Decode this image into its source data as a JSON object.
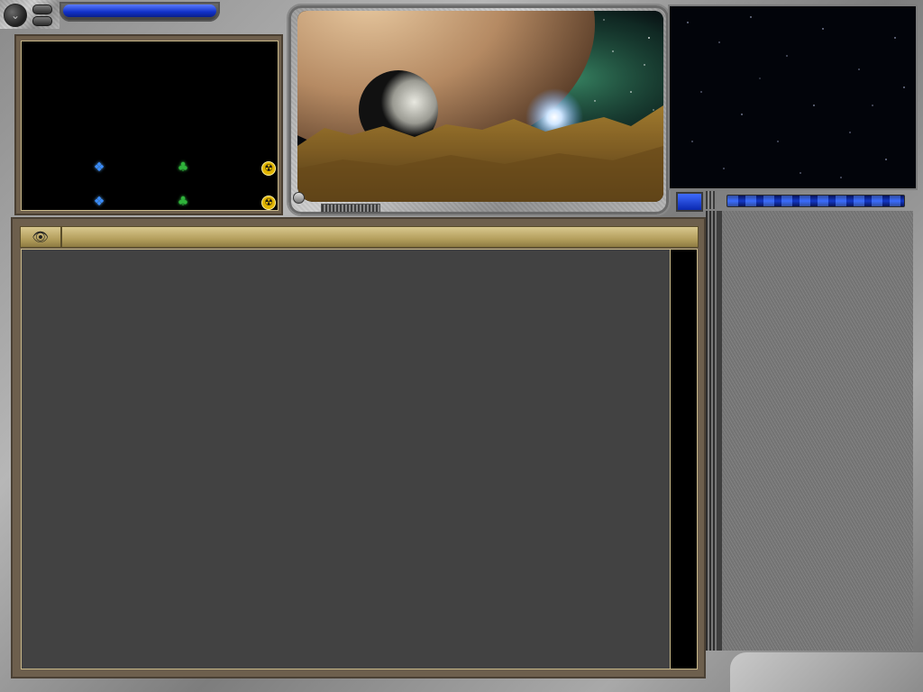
{
  "corner": {
    "round_button_glyph": "⌄",
    "round_button_icon": "chevron-down-icon"
  },
  "colors": {
    "title_bar": "#1030c8",
    "panel_brown": "#6e5f4c",
    "header_gold": "#b49f5d",
    "list_bg": "#424242",
    "crystal_blue": "#3a8cff",
    "plant_green": "#2fb33a",
    "radiation_yellow": "#e0b400",
    "energy_blue": "#1a4cff"
  },
  "resources": {
    "rows": [
      {
        "crystal": {
          "icon": "crystal-icon",
          "glyph": "❖"
        },
        "plant": {
          "icon": "plant-icon",
          "glyph": "♣"
        },
        "radiation": {
          "icon": "radiation-icon",
          "glyph": "☢"
        }
      },
      {
        "crystal": {
          "icon": "crystal-icon",
          "glyph": "❖"
        },
        "plant": {
          "icon": "plant-icon",
          "glyph": "♣"
        },
        "radiation": {
          "icon": "radiation-icon",
          "glyph": "☢"
        }
      }
    ]
  },
  "planet_view": {
    "scene": [
      "gas-giant-planet",
      "moon",
      "bright-star",
      "green-nebula",
      "rocky-terrain"
    ]
  },
  "main_panel": {
    "header_icon": "eye-icon",
    "header_glyph": "👁"
  },
  "energy_bar": {
    "fill_fraction": 1.0
  }
}
